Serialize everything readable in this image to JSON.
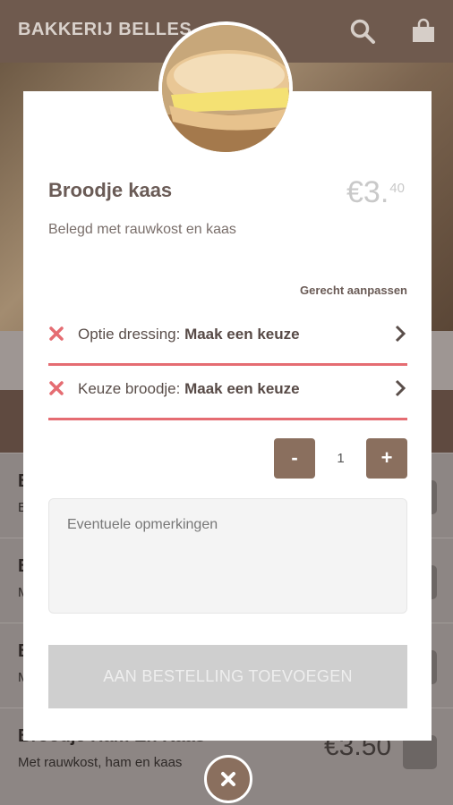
{
  "header": {
    "brand": "BAKKERIJ BELLES"
  },
  "icons": {
    "search": "search-icon",
    "cart": "shopping-bag-icon",
    "close": "close-icon",
    "option_error": "error-x-icon",
    "option_arrow": "chevron-right-icon"
  },
  "background_list": [
    {
      "title": "B",
      "desc": "B",
      "price": ""
    },
    {
      "title": "B",
      "desc": "M",
      "price": ""
    },
    {
      "title": "B",
      "desc": "M",
      "price": ""
    },
    {
      "title": "Broodje Ham En Kaas",
      "desc": "Met rauwkost, ham en kaas",
      "price": "€3.50"
    }
  ],
  "product": {
    "name": "Broodje kaas",
    "price_main": "€3.",
    "price_cents": "40",
    "description": "Belegd met rauwkost en kaas",
    "customize_label": "Gerecht aanpassen"
  },
  "options": [
    {
      "label": "Optie dressing: ",
      "value": "Maak een keuze"
    },
    {
      "label": "Keuze broodje: ",
      "value": "Maak een keuze"
    }
  ],
  "quantity": {
    "minus": "-",
    "value": "1",
    "plus": "+"
  },
  "remarks": {
    "placeholder": "Eventuele opmerkingen"
  },
  "add_button": "AAN BESTELLING TOEVOEGEN",
  "colors": {
    "accent": "#8a6f5e",
    "error": "#e56c72",
    "header": "#6f5a4e"
  }
}
